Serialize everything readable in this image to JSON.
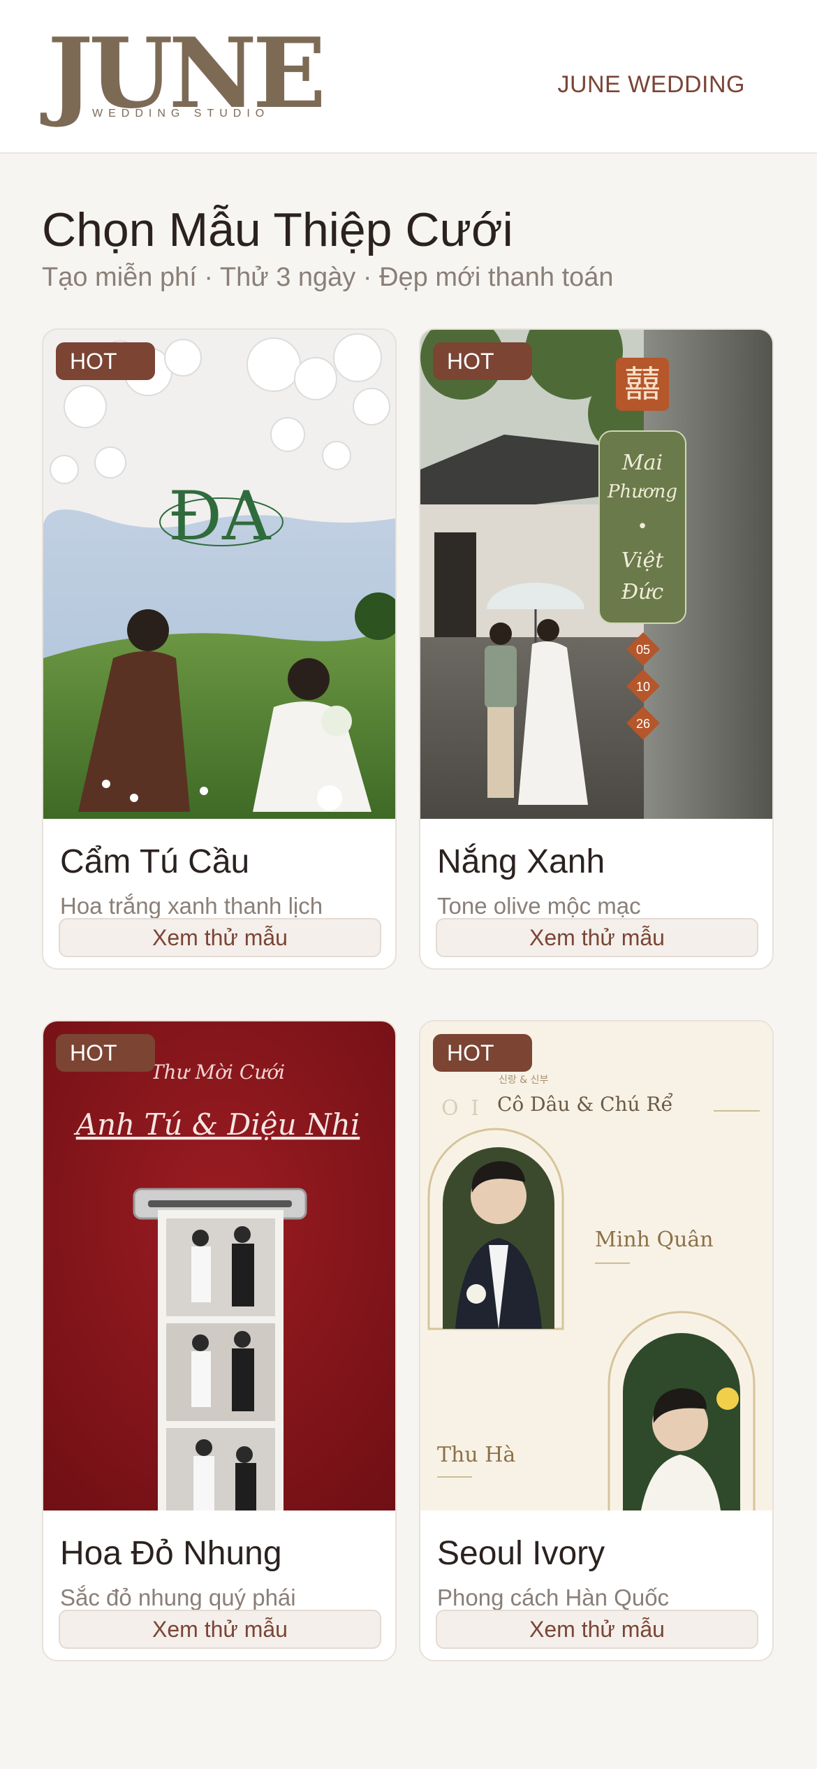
{
  "header": {
    "logo_word": "JUNE",
    "logo_sub": "WEDDING STUDIO",
    "brand_link": "JUNE WEDDING"
  },
  "main": {
    "title": "Chọn Mẫu Thiệp Cưới",
    "subtitle": "Tạo miễn phí · Thử 3 ngày · Đẹp mới thanh toán"
  },
  "cards": [
    {
      "badge": "HOT",
      "title": "Cẩm Tú Cầu",
      "desc": "Hoa trắng xanh thanh lịch",
      "button": "Xem thử mẫu",
      "art": {
        "monogram": "ĐA"
      }
    },
    {
      "badge": "HOT",
      "title": "Nắng Xanh",
      "desc": "Tone olive mộc mạc",
      "button": "Xem thử mẫu",
      "art": {
        "double_happiness": "囍",
        "name_top_1": "Mai",
        "name_top_2": "Phương",
        "separator": "•",
        "name_bottom_1": "Việt",
        "name_bottom_2": "Đức",
        "dates": [
          "05",
          "10",
          "26"
        ]
      }
    },
    {
      "badge": "HOT",
      "title": "Hoa Đỏ Nhung",
      "desc": "Sắc đỏ nhung quý phái",
      "button": "Xem thử mẫu",
      "art": {
        "invite_label": "Thư Mời Cưới",
        "couple": "Anh Tú & Diệu Nhi"
      }
    },
    {
      "badge": "HOT",
      "title": "Seoul Ivory",
      "desc": "Phong cách Hàn Quốc",
      "button": "Xem thử mẫu",
      "art": {
        "korean_label": "신랑 & 신부",
        "number": "O I",
        "heading": "Cô Dâu & Chú Rể",
        "groom": "Minh Quân",
        "bride": "Thu Hà"
      }
    }
  ]
}
